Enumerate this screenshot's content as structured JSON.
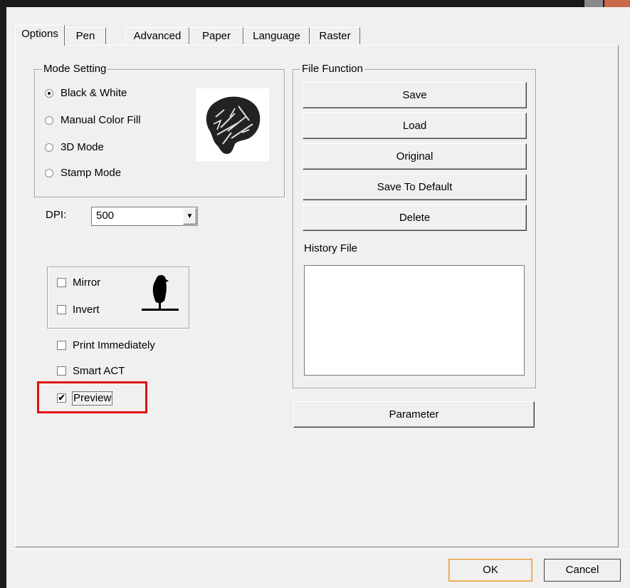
{
  "tabs": [
    "Options",
    "Pen",
    "Advanced",
    "Paper",
    "Language",
    "Raster"
  ],
  "mode_setting": {
    "title": "Mode Setting",
    "options": [
      "Black & White",
      "Manual Color Fill",
      "3D Mode",
      "Stamp Mode"
    ],
    "selected": "Black & White"
  },
  "dpi": {
    "label": "DPI:",
    "value": "500"
  },
  "effects": {
    "mirror": {
      "label": "Mirror",
      "checked": false
    },
    "invert": {
      "label": "Invert",
      "checked": false
    }
  },
  "options": {
    "print_immediately": {
      "label": "Print Immediately",
      "checked": false
    },
    "smart_act": {
      "label": "Smart ACT",
      "checked": false
    },
    "preview": {
      "label": "Preview",
      "checked": true
    }
  },
  "file_function": {
    "title": "File Function",
    "save": "Save",
    "load": "Load",
    "original": "Original",
    "save_default": "Save To Default",
    "delete": "Delete"
  },
  "history": {
    "label": "History File"
  },
  "parameter_label": "Parameter",
  "dialog": {
    "ok": "OK",
    "cancel": "Cancel"
  },
  "colors": {
    "highlight": "#e01010",
    "ok_border": "#e39a3c"
  }
}
